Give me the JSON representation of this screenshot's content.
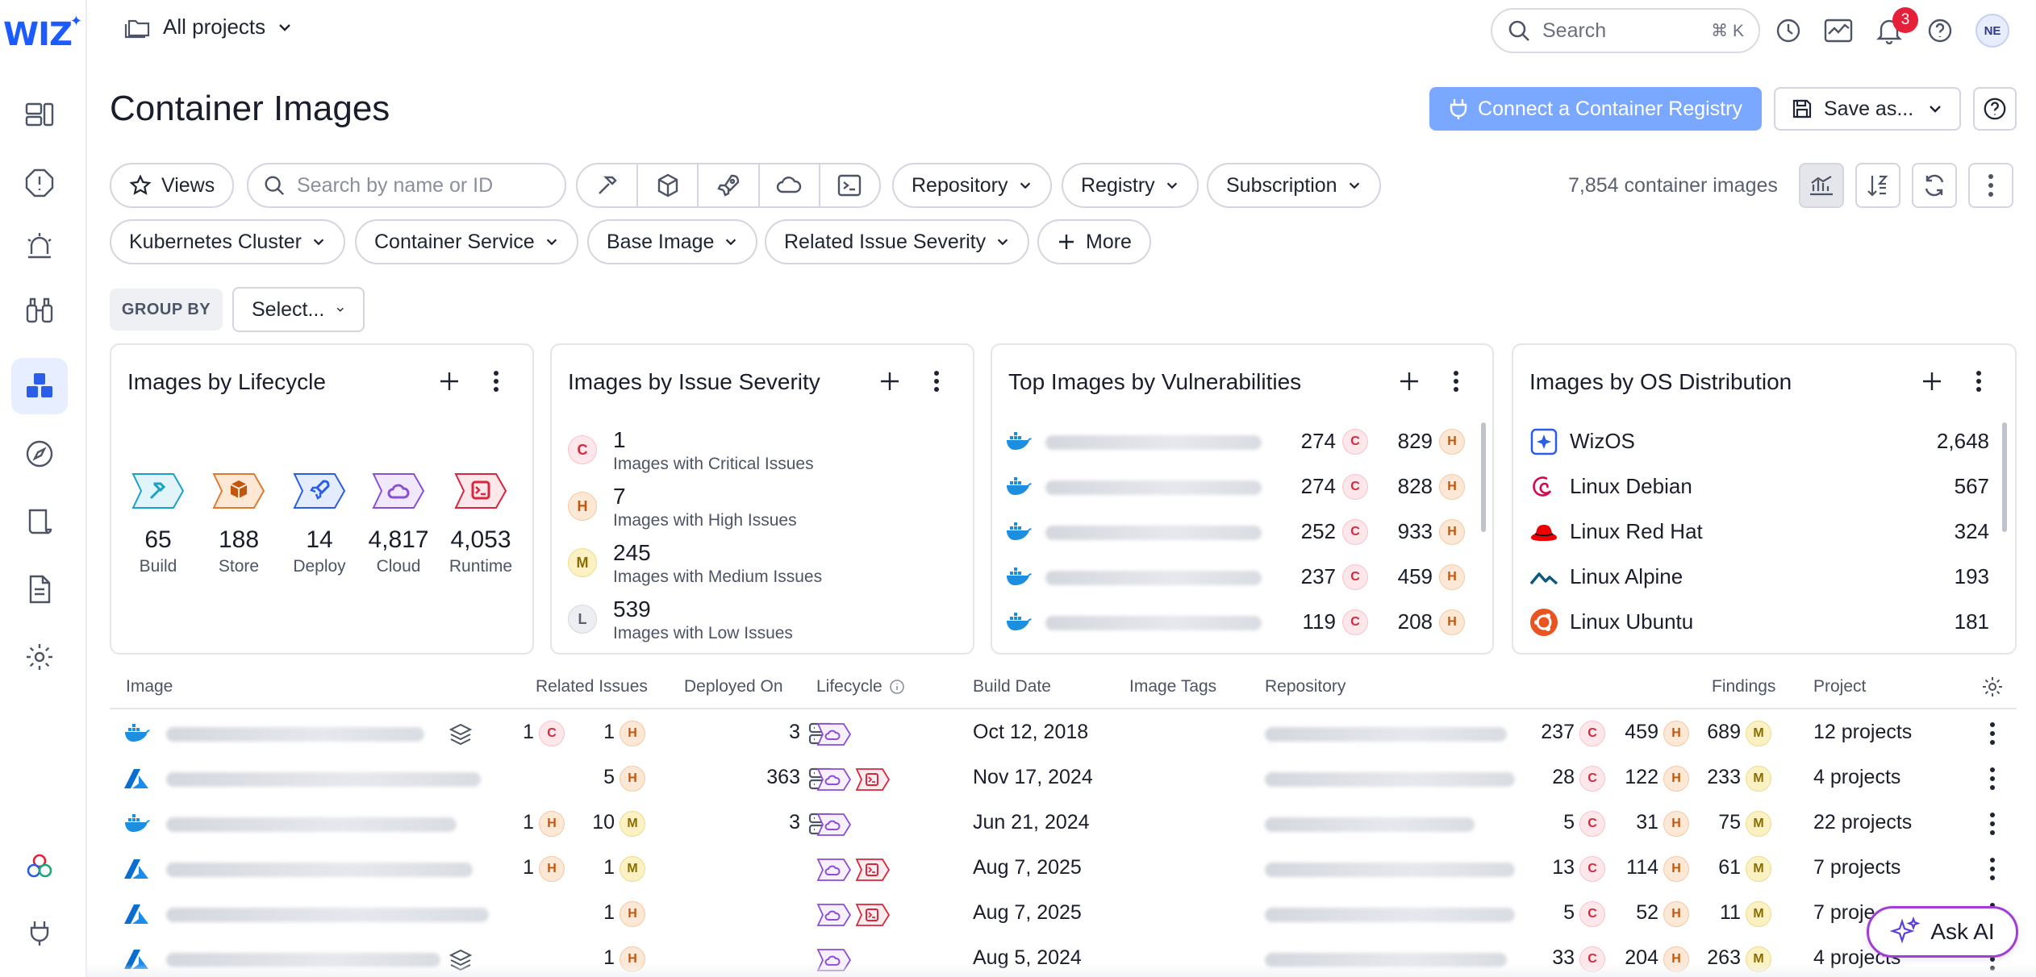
{
  "app": {
    "logo": "WIZ",
    "project_selector": "All projects"
  },
  "top": {
    "search_placeholder": "Search",
    "search_shortcut": "⌘ K",
    "notifications_count": "3",
    "avatar_initials": "NE"
  },
  "page": {
    "title": "Container Images",
    "connect_button": "Connect a Container Registry",
    "save_button": "Save as...",
    "image_count": "7,854 container images"
  },
  "filters": {
    "views": "Views",
    "search_placeholder": "Search by name or ID",
    "repository": "Repository",
    "registry": "Registry",
    "subscription": "Subscription",
    "kubernetes_cluster": "Kubernetes Cluster",
    "container_service": "Container Service",
    "base_image": "Base Image",
    "related_issue_severity": "Related Issue Severity",
    "more": "More"
  },
  "groupby": {
    "label": "GROUP BY",
    "select": "Select..."
  },
  "widgets": {
    "lifecycle": {
      "title": "Images by Lifecycle",
      "items": [
        {
          "value": "65",
          "label": "Build",
          "color": "#1aa1c9"
        },
        {
          "value": "188",
          "label": "Store",
          "color": "#c2560c"
        },
        {
          "value": "14",
          "label": "Deploy",
          "color": "#2b5ee8"
        },
        {
          "value": "4,817",
          "label": "Cloud",
          "color": "#8a4fd6"
        },
        {
          "value": "4,053",
          "label": "Runtime",
          "color": "#d7263d"
        }
      ]
    },
    "severity": {
      "title": "Images by Issue Severity",
      "items": [
        {
          "letter": "C",
          "value": "1",
          "label": "Images with Critical Issues"
        },
        {
          "letter": "H",
          "value": "7",
          "label": "Images with High Issues"
        },
        {
          "letter": "M",
          "value": "245",
          "label": "Images with Medium Issues"
        },
        {
          "letter": "L",
          "value": "539",
          "label": "Images with Low Issues"
        }
      ]
    },
    "top_vulns": {
      "title": "Top Images by Vulnerabilities",
      "rows": [
        {
          "c": "274",
          "h": "829"
        },
        {
          "c": "274",
          "h": "828"
        },
        {
          "c": "252",
          "h": "933"
        },
        {
          "c": "237",
          "h": "459"
        },
        {
          "c": "119",
          "h": "208"
        }
      ]
    },
    "os": {
      "title": "Images by OS Distribution",
      "rows": [
        {
          "name": "WizOS",
          "value": "2,648"
        },
        {
          "name": "Linux Debian",
          "value": "567"
        },
        {
          "name": "Linux Red Hat",
          "value": "324"
        },
        {
          "name": "Linux Alpine",
          "value": "193"
        },
        {
          "name": "Linux Ubuntu",
          "value": "181"
        }
      ]
    }
  },
  "table": {
    "headers": {
      "image": "Image",
      "related_issues": "Related Issues",
      "deployed_on": "Deployed On",
      "lifecycle": "Lifecycle",
      "build_date": "Build Date",
      "image_tags": "Image Tags",
      "repository": "Repository",
      "findings": "Findings",
      "project": "Project"
    },
    "rows": [
      {
        "ri1": "1",
        "ri1s": "C",
        "ri2": "1",
        "ri2s": "H",
        "deployed": "3",
        "build_date": "Oct 12, 2018",
        "fc": "237",
        "fh": "459",
        "fm": "689",
        "project": "12 projects"
      },
      {
        "ri1": "",
        "ri1s": "",
        "ri2": "5",
        "ri2s": "H",
        "deployed": "363",
        "build_date": "Nov 17, 2024",
        "fc": "28",
        "fh": "122",
        "fm": "233",
        "project": "4 projects"
      },
      {
        "ri1": "1",
        "ri1s": "H",
        "ri2": "10",
        "ri2s": "M",
        "deployed": "3",
        "build_date": "Jun 21, 2024",
        "fc": "5",
        "fh": "31",
        "fm": "75",
        "project": "22 projects"
      },
      {
        "ri1": "1",
        "ri1s": "H",
        "ri2": "1",
        "ri2s": "M",
        "deployed": "",
        "build_date": "Aug 7, 2025",
        "fc": "13",
        "fh": "114",
        "fm": "61",
        "project": "7 projects"
      },
      {
        "ri1": "",
        "ri1s": "",
        "ri2": "1",
        "ri2s": "H",
        "deployed": "",
        "build_date": "Aug 7, 2025",
        "fc": "5",
        "fh": "52",
        "fm": "11",
        "project": "7 proje"
      },
      {
        "ri1": "",
        "ri1s": "",
        "ri2": "1",
        "ri2s": "H",
        "deployed": "",
        "build_date": "Aug 5, 2024",
        "fc": "33",
        "fh": "204",
        "fm": "263",
        "project": "4 projects"
      }
    ]
  },
  "ask_ai": "Ask AI"
}
